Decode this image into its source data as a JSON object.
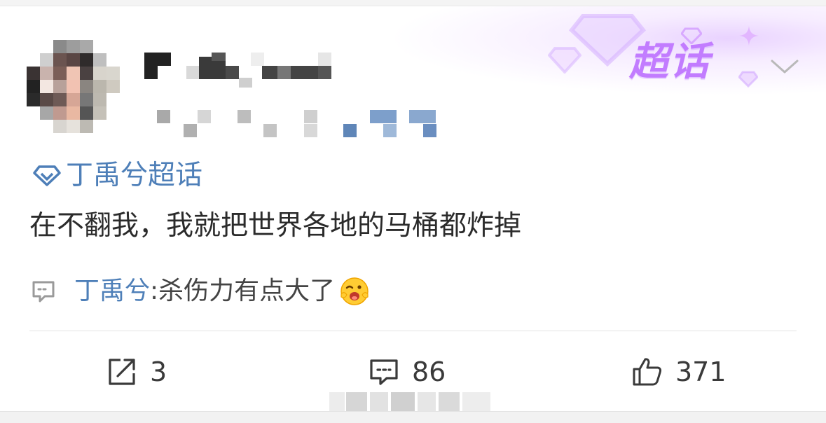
{
  "post": {
    "author_avatar": "avatar-pixelated",
    "author_name": "",
    "badge": {
      "label": "超话",
      "icon": "diamond-icon"
    },
    "topic": {
      "icon": "diamond-icon",
      "label": "丁禹兮超话"
    },
    "text": "在不翻我，我就把世界各地的马桶都炸掉",
    "top_reply": {
      "author": "丁禹兮",
      "separator": ": ",
      "text": "杀伤力有点大了",
      "emoji": "grinning-wink-emoji"
    }
  },
  "actions": {
    "repost": {
      "icon": "repost-icon",
      "count": "3"
    },
    "comment": {
      "icon": "comment-icon",
      "count": "86"
    },
    "like": {
      "icon": "thumbs-up-icon",
      "count": "371"
    }
  },
  "colors": {
    "link": "#4e7fb8",
    "badge": "#c27cff",
    "text": "#2b2b2b"
  }
}
